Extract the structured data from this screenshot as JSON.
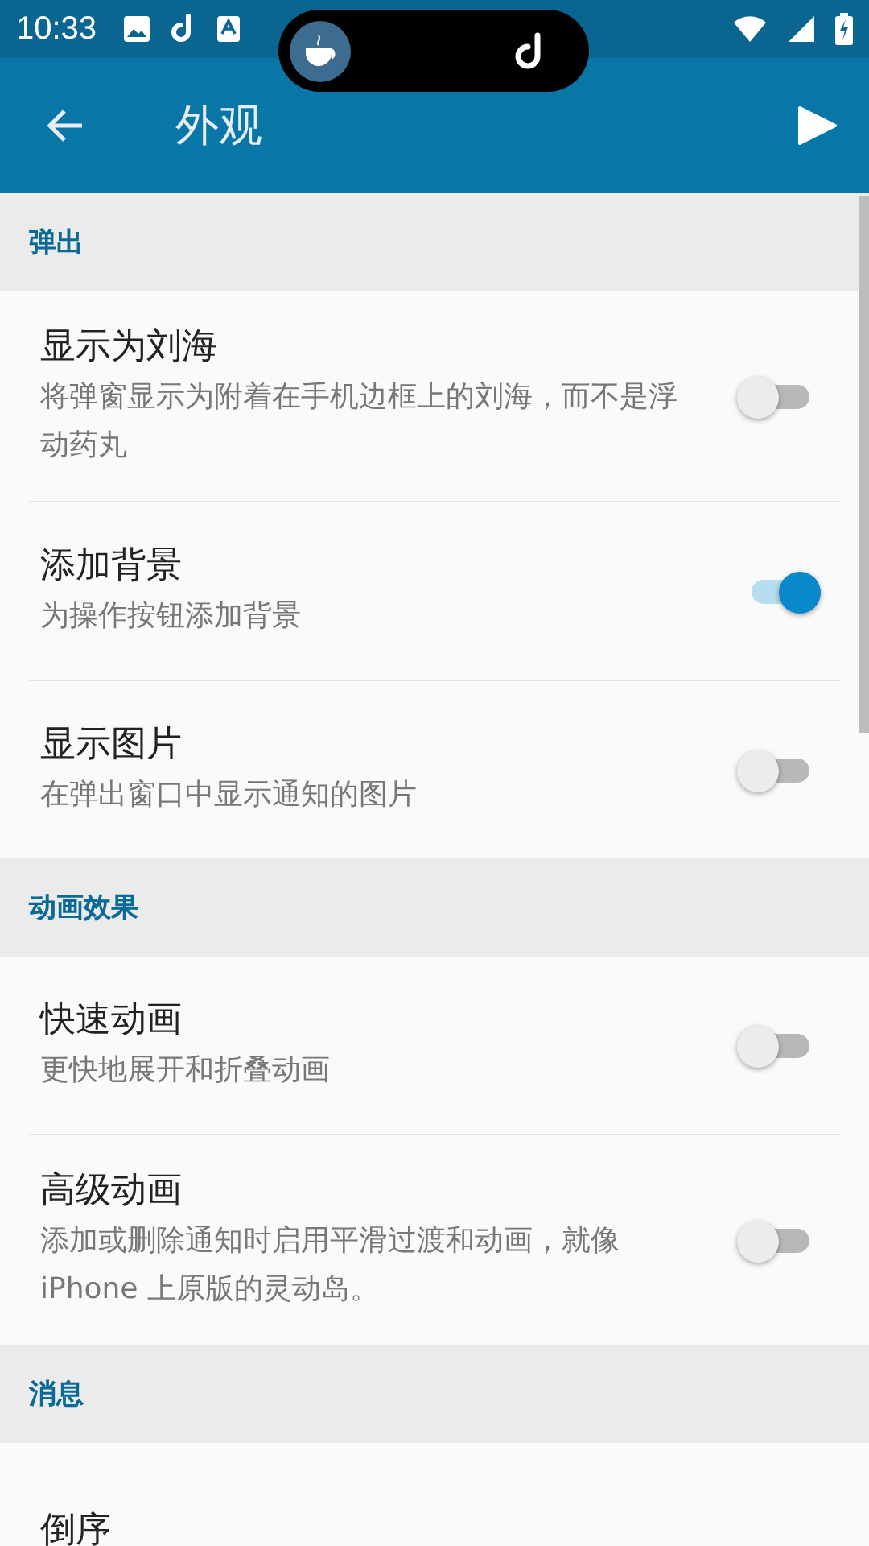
{
  "status_bar": {
    "time": "10:33"
  },
  "app_bar": {
    "title": "外观"
  },
  "sections": [
    {
      "title": "弹出",
      "items": [
        {
          "title": "显示为刘海",
          "summary": "将弹窗显示为附着在手机边框上的刘海，而不是浮动药丸",
          "on": false
        },
        {
          "title": "添加背景",
          "summary": "为操作按钮添加背景",
          "on": true
        },
        {
          "title": "显示图片",
          "summary": "在弹出窗口中显示通知的图片",
          "on": false
        }
      ]
    },
    {
      "title": "动画效果",
      "items": [
        {
          "title": "快速动画",
          "summary": "更快地展开和折叠动画",
          "on": false
        },
        {
          "title": "高级动画",
          "summary": "添加或删除通知时启用平滑过渡和动画，就像 iPhone 上原版的灵动岛。",
          "on": false
        }
      ]
    },
    {
      "title": "消息",
      "items": [
        {
          "title": "倒序"
        }
      ]
    }
  ]
}
